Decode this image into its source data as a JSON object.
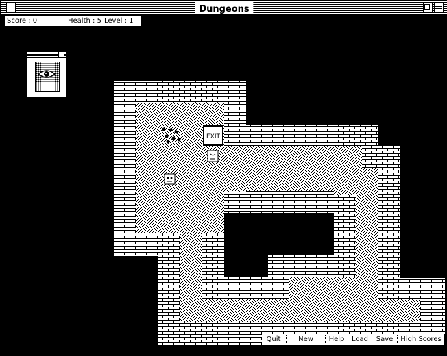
{
  "window": {
    "title": "Dungeons"
  },
  "status": {
    "score_label": "Score : 0",
    "health_label": "Health : 5",
    "level_label": "Level : 1"
  },
  "map": {
    "exit_label": "EXIT"
  },
  "buttons": {
    "quit": "Quit",
    "new_game": "New Game",
    "help": "Help",
    "load": "Load",
    "save": "Save",
    "high_scores": "High Scores"
  }
}
